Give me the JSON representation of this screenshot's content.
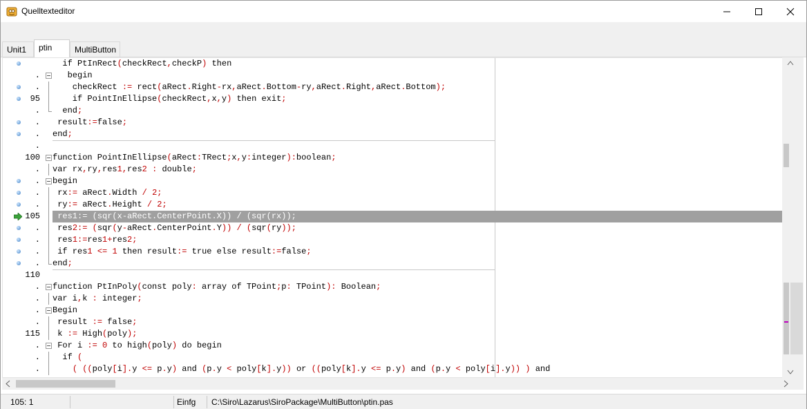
{
  "window": {
    "title": "Quelltexteditor"
  },
  "tabs": [
    {
      "label": "Unit1",
      "active": false
    },
    {
      "label": "ptin",
      "active": true
    },
    {
      "label": "MultiButton",
      "active": false
    }
  ],
  "gutter": [
    {
      "number": "",
      "marker": "breakpoint-dot",
      "fold": "none"
    },
    {
      "number": ".",
      "marker": "none",
      "fold": "box"
    },
    {
      "number": ".",
      "marker": "breakpoint-dot",
      "fold": "line"
    },
    {
      "number": "95",
      "marker": "breakpoint-dot",
      "fold": "line"
    },
    {
      "number": ".",
      "marker": "none",
      "fold": "end"
    },
    {
      "number": ".",
      "marker": "breakpoint-dot",
      "fold": "none"
    },
    {
      "number": ".",
      "marker": "breakpoint-dot",
      "fold": "none"
    },
    {
      "number": ".",
      "marker": "none",
      "fold": "none"
    },
    {
      "number": "100",
      "marker": "none",
      "fold": "box"
    },
    {
      "number": ".",
      "marker": "none",
      "fold": "line"
    },
    {
      "number": ".",
      "marker": "breakpoint-dot",
      "fold": "box"
    },
    {
      "number": ".",
      "marker": "breakpoint-dot",
      "fold": "line"
    },
    {
      "number": ".",
      "marker": "breakpoint-dot",
      "fold": "line"
    },
    {
      "number": "105",
      "marker": "execution-arrow",
      "fold": "line"
    },
    {
      "number": ".",
      "marker": "breakpoint-dot",
      "fold": "line"
    },
    {
      "number": ".",
      "marker": "breakpoint-dot",
      "fold": "line"
    },
    {
      "number": ".",
      "marker": "breakpoint-dot",
      "fold": "line"
    },
    {
      "number": ".",
      "marker": "breakpoint-dot",
      "fold": "end"
    },
    {
      "number": "110",
      "marker": "none",
      "fold": "none"
    },
    {
      "number": ".",
      "marker": "none",
      "fold": "box"
    },
    {
      "number": ".",
      "marker": "none",
      "fold": "line"
    },
    {
      "number": ".",
      "marker": "none",
      "fold": "box"
    },
    {
      "number": ".",
      "marker": "none",
      "fold": "line"
    },
    {
      "number": "115",
      "marker": "none",
      "fold": "line"
    },
    {
      "number": ".",
      "marker": "none",
      "fold": "box"
    },
    {
      "number": ".",
      "marker": "none",
      "fold": "line"
    },
    {
      "number": ".",
      "marker": "none",
      "fold": "line"
    }
  ],
  "code_lines": [
    "  if PtInRect(checkRect,checkP) then",
    "   begin",
    "    checkRect := rect(aRect.Right-rx,aRect.Bottom-ry,aRect.Right,aRect.Bottom);",
    "    if PointInEllipse(checkRect,x,y) then exit;",
    "  end;",
    " result:=false;",
    "end;",
    "",
    "function PointInEllipse(aRect:TRect;x,y:integer):boolean;",
    "var rx,ry,res1,res2 : double;",
    "begin",
    " rx:= aRect.Width / 2;",
    " ry:= aRect.Height / 2;",
    " res1:= (sqr(x-aRect.CenterPoint.X)) / (sqr(rx));",
    " res2:= (sqr(y-aRect.CenterPoint.Y)) / (sqr(ry));",
    " res1:=res1+res2;",
    " if res1 <= 1 then result:= true else result:=false;",
    "end;",
    "",
    "function PtInPoly(const poly: array of TPoint;p: TPoint): Boolean;",
    "var i,k : integer;",
    "Begin",
    " result := false;",
    " k := High(poly);",
    " For i := 0 to high(poly) do begin",
    "  if (",
    "    ( ((poly[i].y <= p.y) and (p.y < poly[k].y)) or ((poly[k].y <= p.y) and (p.y < poly[i].y)) ) and"
  ],
  "execution_line_index": 13,
  "status": {
    "position": "105:  1",
    "mode": "Einfg",
    "file_path": "C:\\Siro\\Lazarus\\SiroPackage\\MultiButton\\ptin.pas"
  },
  "colors": {
    "symbol": "#c00000",
    "execution_highlight": "#a0a0a0",
    "breakpoint_dot": "#3f7fc4",
    "execution_arrow": "#3aa23a"
  },
  "icons": {
    "app": "app-icon",
    "minimize": "minimize-icon",
    "maximize": "maximize-icon",
    "close": "close-icon"
  }
}
